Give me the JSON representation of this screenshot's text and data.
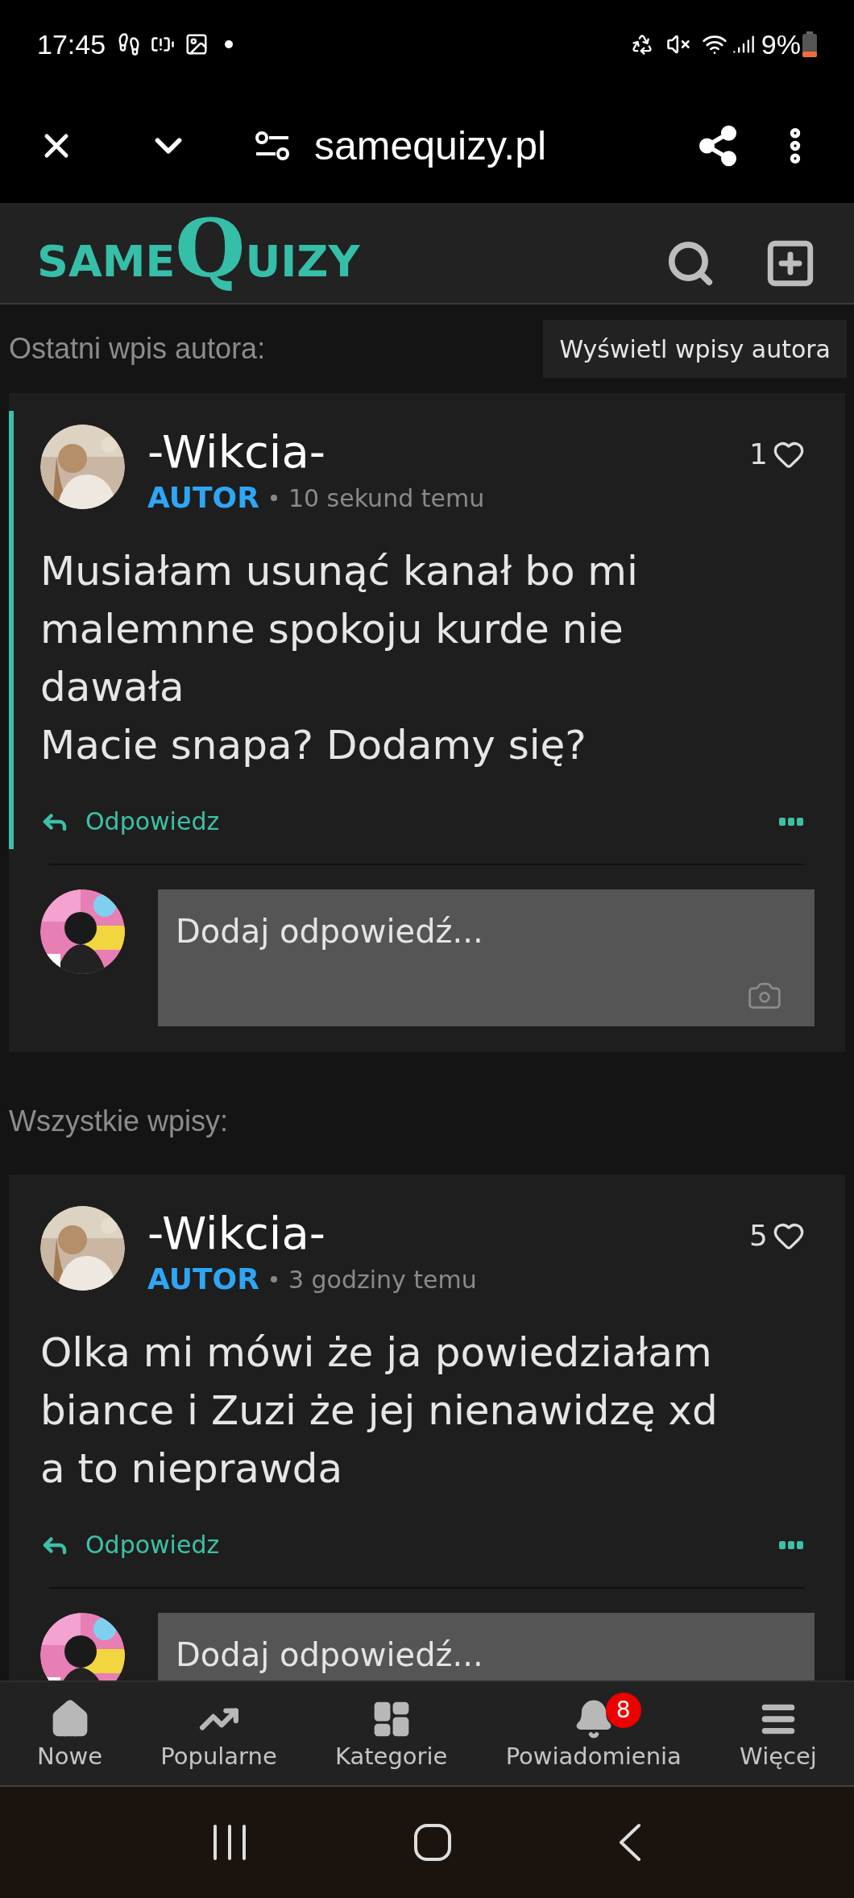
{
  "status_bar": {
    "time": "17:45",
    "battery": "9%"
  },
  "browser": {
    "url": "samequizy.pl"
  },
  "site_header": {
    "logo": [
      "SAME",
      "Q",
      "UIZY"
    ]
  },
  "sections": [
    {
      "heading": "Ostatni wpis autora:",
      "button": "Wyświetl wpisy autora",
      "posts": [
        {
          "author": "-Wikcia-",
          "badge": "AUTOR",
          "time": "10 sekund temu",
          "likes": "1",
          "highlighted": true,
          "body": "Musiałam usunąć kanał bo mi malemnne spokoju kurde nie dawała\nMacie snapa? Dodamy się?",
          "reply_label": "Odpowiedz",
          "reply_field": {
            "placeholder": "Dodaj odpowiedź...",
            "camera": true
          }
        }
      ]
    },
    {
      "heading": "Wszystkie wpisy:",
      "posts": [
        {
          "author": "-Wikcia-",
          "badge": "AUTOR",
          "time": "3 godziny temu",
          "likes": "5",
          "highlighted": false,
          "body": "Olka mi mówi że ja powiedziałam biance i Zuzi że jej nienawidzę xd a to nieprawda",
          "reply_label": "Odpowiedz",
          "reply_field": {
            "placeholder": "Dodaj odpowiedź..."
          }
        }
      ]
    }
  ],
  "bottom_nav": [
    {
      "kind": "home",
      "label": "Nowe"
    },
    {
      "kind": "trending",
      "label": "Popularne"
    },
    {
      "kind": "grid",
      "label": "Kategorie"
    },
    {
      "kind": "bell",
      "label": "Powiadomienia",
      "badge": "8"
    },
    {
      "kind": "menu",
      "label": "Więcej"
    }
  ]
}
